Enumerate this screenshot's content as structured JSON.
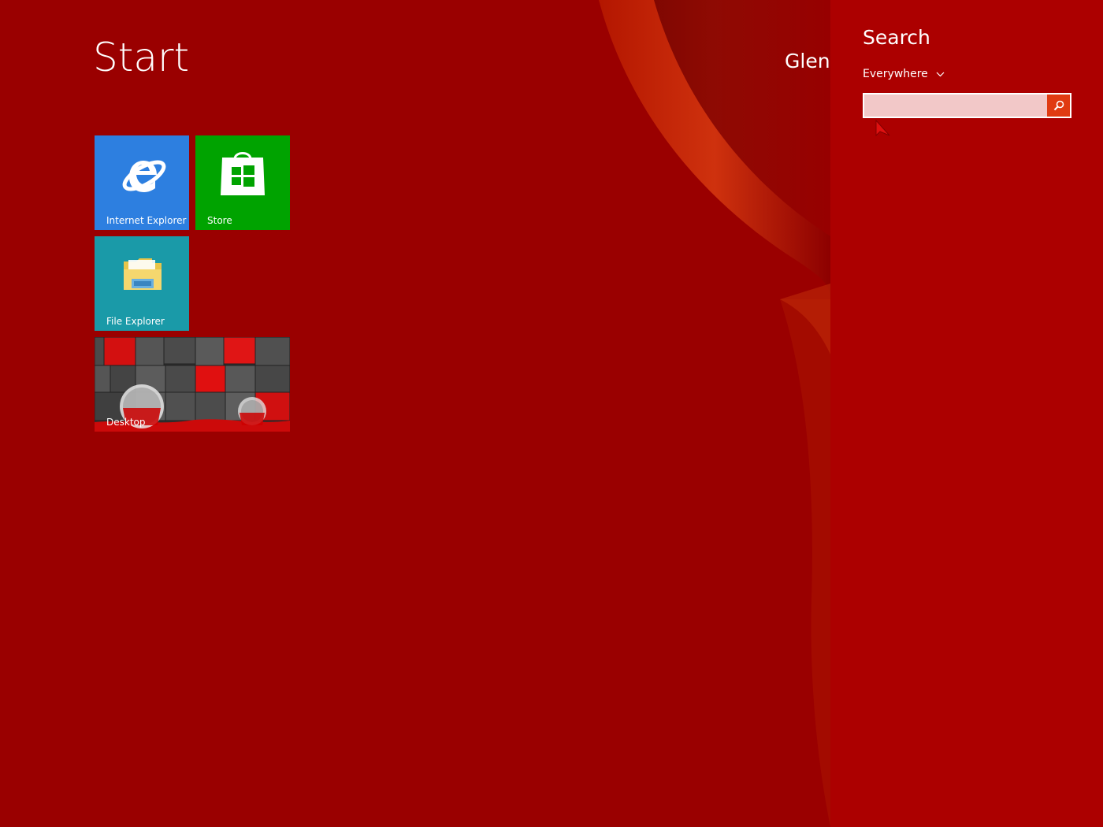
{
  "start": {
    "title": "Start",
    "user_name": "Glenn"
  },
  "tiles": [
    {
      "label": "Internet Explorer",
      "icon": "internet-explorer-icon",
      "color": "#2d7fe0"
    },
    {
      "label": "Store",
      "icon": "store-icon",
      "color": "#00a300"
    },
    {
      "label": "File Explorer",
      "icon": "file-explorer-icon",
      "color": "#1a9aa8"
    },
    {
      "label": "Desktop",
      "icon": "desktop-wallpaper",
      "color": "#3a3a3a"
    }
  ],
  "search": {
    "title": "Search",
    "scope": "Everywhere",
    "query": "",
    "accent": "#e03b12"
  },
  "colors": {
    "background": "#9a0000",
    "charm": "#ac0000"
  }
}
